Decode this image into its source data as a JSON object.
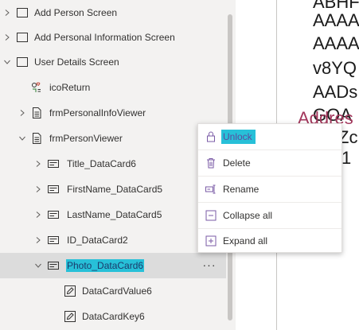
{
  "tree": {
    "items": [
      {
        "label": "Add Person Screen"
      },
      {
        "label": "Add Personal Information Screen"
      },
      {
        "label": "User Details Screen"
      },
      {
        "label": "icoReturn"
      },
      {
        "label": "frmPersonalInfoViewer"
      },
      {
        "label": "frmPersonViewer"
      },
      {
        "label": "Title_DataCard6"
      },
      {
        "label": "FirstName_DataCard5"
      },
      {
        "label": "LastName_DataCard5"
      },
      {
        "label": "ID_DataCard2"
      },
      {
        "label": "Photo_DataCard6"
      },
      {
        "label": "DataCardValue6"
      },
      {
        "label": "DataCardKey6"
      }
    ],
    "more_label": "···"
  },
  "context_menu": {
    "items": [
      {
        "label": "Unlock",
        "icon": "lock-icon"
      },
      {
        "label": "Delete",
        "icon": "trash-icon"
      },
      {
        "label": "Rename",
        "icon": "rename-icon"
      },
      {
        "label": "Collapse all",
        "icon": "collapse-icon"
      },
      {
        "label": "Expand all",
        "icon": "expand-icon"
      }
    ]
  },
  "canvas": {
    "lines": [
      "ABHF",
      "AAAA",
      "AAAA",
      "v8YQ",
      "AADs",
      "GOA",
      "Zc",
      "1"
    ],
    "overlay": "Addres"
  },
  "colors": {
    "highlight": "#27c0d8",
    "selected_row": "#dcdcdc",
    "panel_bg": "#f3f2f1"
  }
}
